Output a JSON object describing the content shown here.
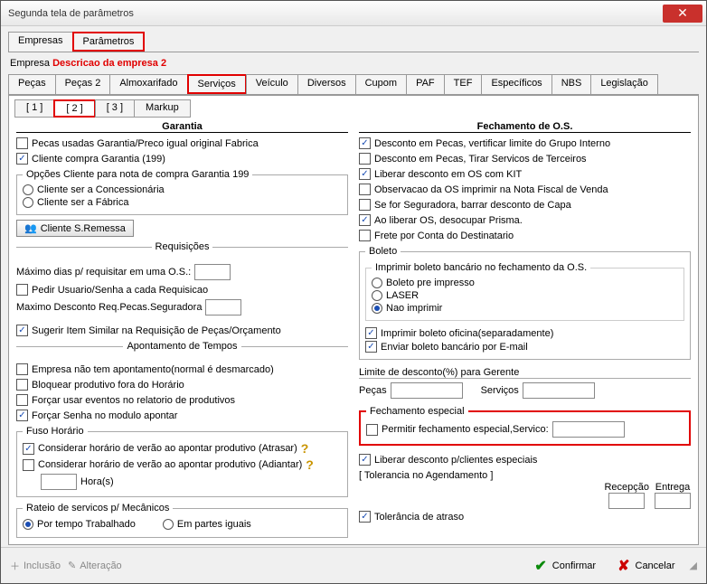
{
  "title": "Segunda tela de parâmetros",
  "topTabs": {
    "empresas": "Empresas",
    "parametros": "Parâmetros"
  },
  "empresa": {
    "label": "Empresa",
    "desc": "Descricao da empresa 2"
  },
  "moduleTabs": [
    "Peças",
    "Peças 2",
    "Almoxarifado",
    "Serviços",
    "Veículo",
    "Diversos",
    "Cupom",
    "PAF",
    "TEF",
    "Específicos",
    "NBS",
    "Legislação"
  ],
  "pageTabs": [
    "[ 1 ]",
    "[ 2 ]",
    "[ 3 ]",
    "Markup"
  ],
  "garantia": {
    "title": "Garantia",
    "pecasUsadas": "Pecas usadas Garantia/Preco igual original Fabrica",
    "clienteCompra": "Cliente compra Garantia (199)",
    "opcoesLegend": "Opções Cliente para nota de compra Garantia 199",
    "concess": "Cliente ser a Concessionária",
    "fabrica": "Cliente ser a Fábrica",
    "btnRemessa": "Cliente S.Remessa"
  },
  "requisicoes": {
    "legend": "Requisições",
    "maxDias": "Máximo dias p/ requisitar em uma O.S.:",
    "pedirUsuario": "Pedir Usuario/Senha a cada Requisicao",
    "maxDesc": "Maximo Desconto Req.Pecas.Seguradora",
    "sugerir": "Sugerir Item Similar na Requisição de Peças/Orçamento"
  },
  "apontamento": {
    "legend": "Apontamento de Tempos",
    "empresaNao": "Empresa não tem apontamento(normal é desmarcado)",
    "bloquear": "Bloquear produtivo fora do Horário",
    "forcarEventos": "Forçar usar eventos no relatorio de produtivos",
    "forcarSenha": "Forçar Senha no modulo apontar"
  },
  "fuso": {
    "legend": "Fuso Horário",
    "atrasar": "Considerar horário de verão ao apontar produtivo (Atrasar)",
    "adiantar": "Considerar horário de verão ao apontar produtivo (Adiantar)",
    "horas": "Hora(s)"
  },
  "rateio": {
    "legend": "Rateio de servicos p/ Mecânicos",
    "tempo": "Por tempo Trabalhado",
    "partes": "Em partes iguais"
  },
  "fechamento": {
    "title": "Fechamento de O.S.",
    "descPecasGrupo": "Desconto em Pecas, vertificar limite do Grupo Interno",
    "descPecasTirar": "Desconto em Pecas, Tirar Servicos de Terceiros",
    "liberarKit": "Liberar desconto em OS com KIT",
    "obsOS": "Observacao da OS imprimir na Nota Fiscal de Venda",
    "seguradora": "Se for Seguradora, barrar desconto de Capa",
    "liberarPrisma": "Ao liberar OS, desocupar Prisma.",
    "freteConta": "Frete por Conta do Destinatario"
  },
  "boleto": {
    "legend": "Boleto",
    "sublegend": "Imprimir boleto bancário no fechamento da O.S.",
    "pre": "Boleto pre impresso",
    "laser": "LASER",
    "nao": "Nao imprimir",
    "imprimirSep": "Imprimir boleto oficina(separadamente)",
    "enviarEmail": "Enviar boleto bancário por E-mail"
  },
  "gerente": {
    "legend": "Limite de desconto(%) para Gerente",
    "pecas": "Peças",
    "servicos": "Serviços"
  },
  "especial": {
    "legend": "Fechamento especial",
    "permitir": "Permitir fechamento especial,Servico:"
  },
  "liberarClientes": "Liberar desconto p/clientes especiais",
  "tolerancia": {
    "legend": "[ Tolerancia no Agendamento ]",
    "recepcao": "Recepção",
    "entrega": "Entrega",
    "atraso": "Tolerância de atraso"
  },
  "footer": {
    "inclusao": "Inclusão",
    "alteracao": "Alteração",
    "confirmar": "Confirmar",
    "cancelar": "Cancelar"
  }
}
